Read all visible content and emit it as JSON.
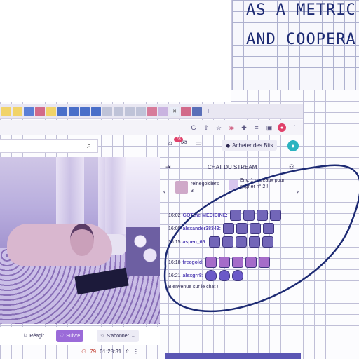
{
  "notebook": {
    "line1": "AS A METRIC",
    "line2": "AND COOPERA"
  },
  "browser": {
    "tab_icons": [
      "tab-icon",
      "tab-icon",
      "tab-icon",
      "tab-icon",
      "tab-icon",
      "tab-icon",
      "tab-icon",
      "tab-icon",
      "tab-icon",
      "tab-icon",
      "tab-icon",
      "tab-icon",
      "tab-icon",
      "tab-icon",
      "tab-icon",
      "tab-icon",
      "tab-icon",
      "tab-icon",
      "tab-icon",
      "tab-icon",
      "tab-icon",
      "tab-icon"
    ],
    "active_tab_close": "✕",
    "new_tab": "+",
    "toolbar_icons": [
      "google-icon",
      "share-icon",
      "bookmark-star-icon",
      "extension-icon",
      "puzzle-icon",
      "media-icon",
      "sidebar-icon",
      "profile-icon",
      "menu-icon"
    ]
  },
  "header": {
    "notifications_badge": "78",
    "bits_label": "Acheter des Bits"
  },
  "actions": {
    "react_label": "Réagir",
    "follow_label": "Suivre",
    "subscribe_label": "S'abonner",
    "viewers": "79",
    "uptime": "01:28:31"
  },
  "chat": {
    "title": "CHAT DU STREAM",
    "promo": {
      "name": "reinegoldiers",
      "count": "3",
      "text": "Env. 1 cadeaux pour gagner n° 2 !"
    },
    "messages": [
      {
        "time": "16:02",
        "user": "GOTthe MEDICINE:",
        "emotes": 4
      },
      {
        "time": "16:09",
        "user": "alexander38343:",
        "emotes": 4
      },
      {
        "time": "16:15",
        "user": "aspen_65:",
        "emotes": 5
      },
      {
        "time": "16:18",
        "user": "freegold:",
        "emotes": 5
      },
      {
        "time": "16:21",
        "user": "alexgrr8:",
        "emotes": 3
      }
    ],
    "welcome": "Bienvenue sur le chat !"
  },
  "colors": {
    "accent": "#9b6bd9",
    "badge": "#e0406a",
    "ink": "#1d2a73"
  }
}
